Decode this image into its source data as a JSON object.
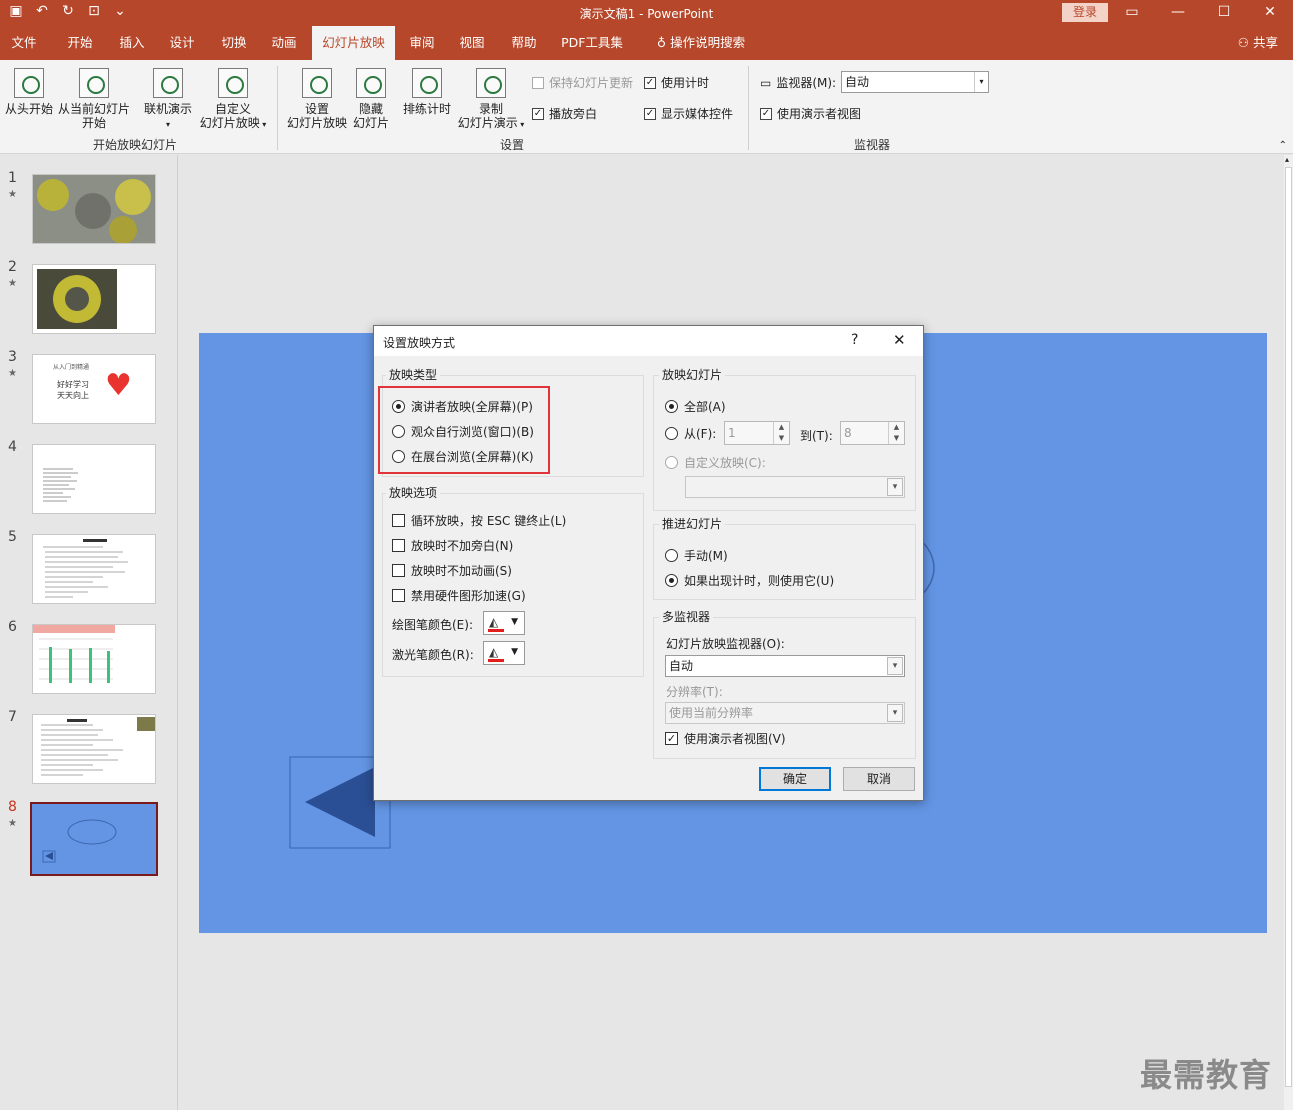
{
  "window": {
    "title": "演示文稿1  -  PowerPoint",
    "login": "登录"
  },
  "tabs": [
    "文件",
    "开始",
    "插入",
    "设计",
    "切换",
    "动画",
    "幻灯片放映",
    "审阅",
    "视图",
    "帮助",
    "PDF工具集",
    "操作说明搜索"
  ],
  "active_tab": "幻灯片放映",
  "share": "共享",
  "ribbon": {
    "from_start": "从头开始",
    "from_current_1": "从当前幻灯片",
    "from_current_2": "开始",
    "online": "联机演示",
    "custom_1": "自定义",
    "custom_2": "幻灯片放映",
    "group_start": "开始放映幻灯片",
    "setup_1": "设置",
    "setup_2": "幻灯片放映",
    "hide_1": "隐藏",
    "hide_2": "幻灯片",
    "rehearse": "排练计时",
    "record_1": "录制",
    "record_2": "幻灯片演示",
    "keep_updated": "保持幻灯片更新",
    "play_narration": "播放旁白",
    "use_timings": "使用计时",
    "show_media": "显示媒体控件",
    "group_setup": "设置",
    "monitor_label": "监视器(M):",
    "monitor_value": "自动",
    "presenter_view": "使用演示者视图",
    "group_monitor": "监视器"
  },
  "slides": [
    {
      "num": "1",
      "star": "★"
    },
    {
      "num": "2",
      "star": "★"
    },
    {
      "num": "3",
      "star": "★",
      "text1": "从入门到精通",
      "text2": "好好学习",
      "text3": "天天向上"
    },
    {
      "num": "4",
      "star": ""
    },
    {
      "num": "5",
      "star": ""
    },
    {
      "num": "6",
      "star": ""
    },
    {
      "num": "7",
      "star": ""
    },
    {
      "num": "8",
      "star": "★"
    }
  ],
  "dialog": {
    "title": "设置放映方式",
    "help": "?",
    "close": "✕",
    "show_type": {
      "legend": "放映类型",
      "options": [
        "演讲者放映(全屏幕)(P)",
        "观众自行浏览(窗口)(B)",
        "在展台浏览(全屏幕)(K)"
      ],
      "selected": 0
    },
    "show_options": {
      "legend": "放映选项",
      "loop": "循环放映，按 ESC 键终止(L)",
      "no_narration": "放映时不加旁白(N)",
      "no_animation": "放映时不加动画(S)",
      "no_hw_accel": "禁用硬件图形加速(G)",
      "pen_color": "绘图笔颜色(E):",
      "laser_color": "激光笔颜色(R):"
    },
    "show_slides": {
      "legend": "放映幻灯片",
      "all": "全部(A)",
      "from": "从(F):",
      "from_value": "1",
      "to": "到(T):",
      "to_value": "8",
      "custom": "自定义放映(C):"
    },
    "advance": {
      "legend": "推进幻灯片",
      "manual": "手动(M)",
      "timings": "如果出现计时，则使用它(U)"
    },
    "multi_monitor": {
      "legend": "多监视器",
      "monitor_label": "幻灯片放映监视器(O):",
      "monitor_value": "自动",
      "resolution_label": "分辨率(T):",
      "resolution_value": "使用当前分辨率",
      "presenter_view": "使用演示者视图(V)"
    },
    "ok": "确定",
    "cancel": "取消"
  },
  "watermark": "最需教育",
  "colors": {
    "accent": "#b7472a",
    "slide_bg": "#6395e4",
    "highlight": "#e0343a"
  }
}
